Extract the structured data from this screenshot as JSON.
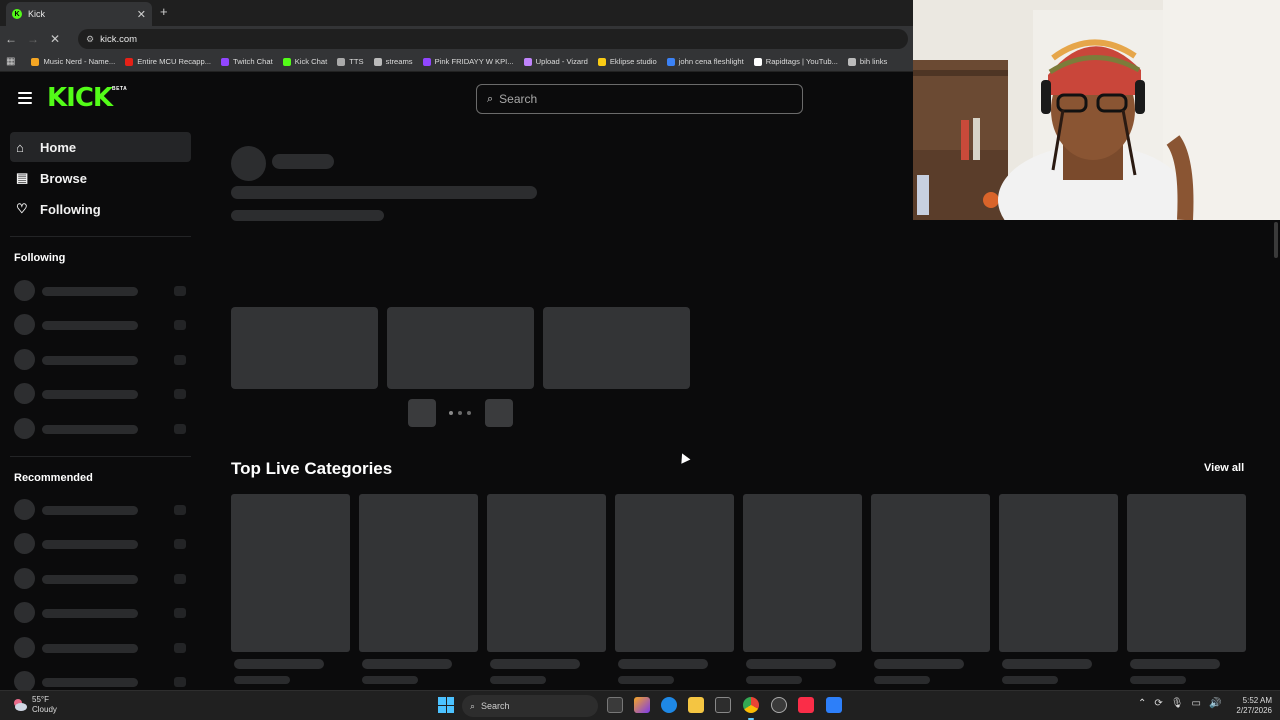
{
  "browser": {
    "tab": {
      "title": "Kick"
    },
    "url": "kick.com",
    "bookmarks": [
      {
        "label": "Music Nerd - Name...",
        "color": "#f5a623"
      },
      {
        "label": "Entire MCU Recapp...",
        "color": "#e62117"
      },
      {
        "label": "Twitch Chat",
        "color": "#9146ff"
      },
      {
        "label": "Kick Chat",
        "color": "#53fc18"
      },
      {
        "label": "TTS",
        "color": "#aaaaaa"
      },
      {
        "label": "streams",
        "color": "#bbbbbb"
      },
      {
        "label": "Pink FRIDAYY W KPI...",
        "color": "#9146ff"
      },
      {
        "label": "Upload - Vizard",
        "color": "#c084fc"
      },
      {
        "label": "Eklipse studio",
        "color": "#facc15"
      },
      {
        "label": "john cena fleshlight",
        "color": "#3b82f6"
      },
      {
        "label": "Rapidtags | YouTub...",
        "color": "#ffffff"
      },
      {
        "label": "bih links",
        "color": "#bbbbbb"
      }
    ]
  },
  "kick": {
    "brand_color": "#53fc18",
    "logo_text": "KICK",
    "logo_badge": "BETA",
    "search_placeholder": "Search",
    "nav": [
      {
        "label": "Home",
        "icon": "home-icon",
        "active": true
      },
      {
        "label": "Browse",
        "icon": "browse-icon",
        "active": false
      },
      {
        "label": "Following",
        "icon": "heart-icon",
        "active": false
      }
    ],
    "sidebar_sections": [
      {
        "title": "Following"
      },
      {
        "title": "Recommended"
      }
    ],
    "categories_section": {
      "title": "Top Live Categories",
      "view_all_label": "View all"
    }
  },
  "taskbar": {
    "weather": {
      "temp": "55°F",
      "condition": "Cloudy"
    },
    "search_label": "Search",
    "time": "5:52 AM",
    "date": "2/27/2026"
  }
}
